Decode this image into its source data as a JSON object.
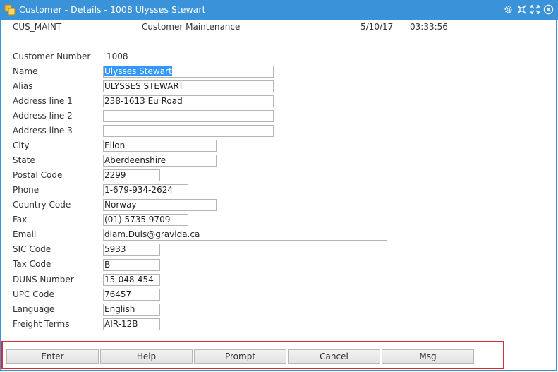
{
  "window": {
    "title": "Customer - Details - 1008 Ulysses Stewart",
    "accent_color": "#3a93d8",
    "highlight_color": "#d22f3a",
    "icons": [
      "app-icon",
      "settings-icon",
      "minimize-icon",
      "maximize-icon",
      "close-icon"
    ]
  },
  "header": {
    "program": "CUS_MAINT",
    "description": "Customer Maintenance",
    "date": "5/10/17",
    "time": "03:33:56"
  },
  "form": {
    "customer_number_label": "Customer Number",
    "customer_number": "1008",
    "fields": [
      {
        "label": "Name",
        "value": "Ulysses Stewart"
      },
      {
        "label": "Alias",
        "value": "ULYSSES STEWART"
      },
      {
        "label": "Address line 1",
        "value": "238-1613 Eu Road"
      },
      {
        "label": "Address line 2",
        "value": ""
      },
      {
        "label": "Address line 3",
        "value": ""
      },
      {
        "label": "City",
        "value": "Ellon"
      },
      {
        "label": "State",
        "value": "Aberdeenshire"
      },
      {
        "label": "Postal Code",
        "value": "2299"
      },
      {
        "label": "Phone",
        "value": "1-679-934-2624"
      },
      {
        "label": "Country Code",
        "value": "Norway"
      },
      {
        "label": "Fax",
        "value": "(01) 5735 9709"
      },
      {
        "label": "Email",
        "value": "diam.Duis@gravida.ca"
      },
      {
        "label": "SIC Code",
        "value": "5933"
      },
      {
        "label": "Tax Code",
        "value": "B"
      },
      {
        "label": "DUNS Number",
        "value": "15-048-454"
      },
      {
        "label": "UPC Code",
        "value": "76457"
      },
      {
        "label": "Language",
        "value": "English"
      },
      {
        "label": "Freight Terms",
        "value": "AIR-12B"
      }
    ]
  },
  "buttons": {
    "enter": "Enter",
    "help": "Help",
    "prompt": "Prompt",
    "cancel": "Cancel",
    "msg": "Msg"
  }
}
